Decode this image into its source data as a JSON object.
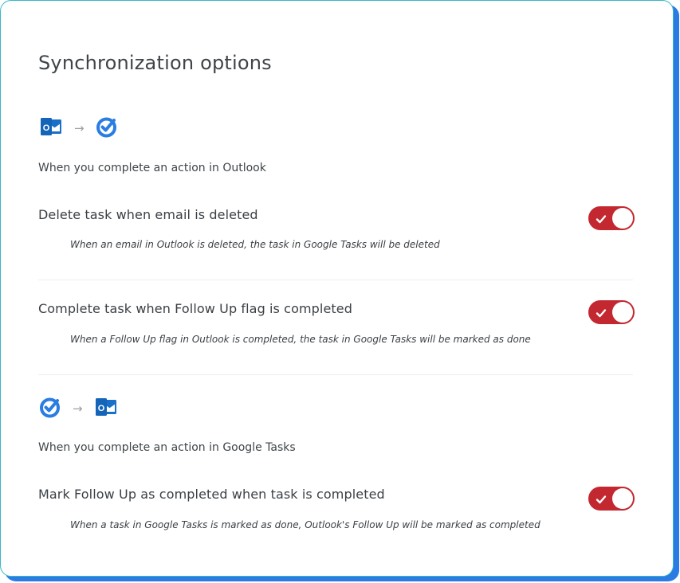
{
  "title": "Synchronization options",
  "sections": [
    {
      "from_icon": "outlook-icon",
      "to_icon": "google-tasks-icon",
      "arrow": "→",
      "description": "When you complete an action in Outlook",
      "options": [
        {
          "label": "Delete task when email is deleted",
          "help": "When an email in Outlook is deleted, the task in Google Tasks will be deleted",
          "enabled": true
        },
        {
          "label": "Complete task when Follow Up flag is completed",
          "help": "When a Follow Up flag in Outlook is completed, the task in Google Tasks will be marked as done",
          "enabled": true
        }
      ]
    },
    {
      "from_icon": "google-tasks-icon",
      "to_icon": "outlook-icon",
      "arrow": "→",
      "description": "When you complete an action in Google Tasks",
      "options": [
        {
          "label": "Mark Follow Up as completed when task is completed",
          "help": "When a task in Google Tasks is marked as done, Outlook's Follow Up will be marked as completed",
          "enabled": true
        }
      ]
    }
  ],
  "colors": {
    "toggle_on": "#c3272f",
    "card_border": "#39b7c7",
    "card_shadow": "#2b7be4",
    "outlook_blue": "#1a6fc9",
    "google_tasks_blue": "#2a7de1"
  }
}
